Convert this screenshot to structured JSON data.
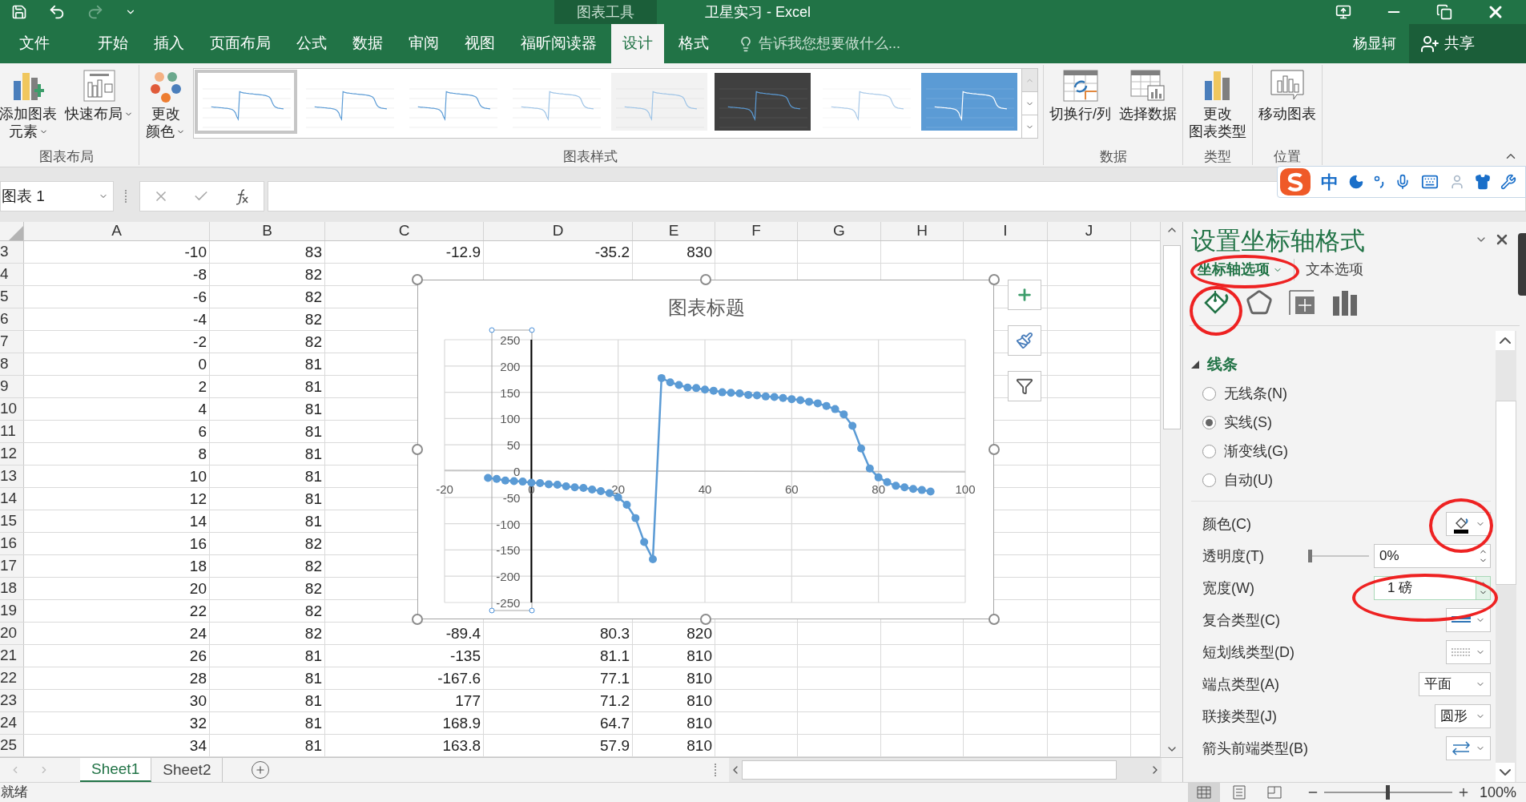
{
  "quick_access": [
    {
      "kind": "save",
      "disabled": false
    },
    {
      "kind": "undo",
      "disabled": false
    },
    {
      "kind": "redo",
      "disabled": true
    },
    {
      "kind": "customize",
      "disabled": false
    }
  ],
  "title_bar": {
    "context_label": "图表工具",
    "title": "卫星实习 - Excel"
  },
  "ribbon_tabs": [
    {
      "label": "文件",
      "selected": false
    },
    {
      "label": "开始",
      "selected": false
    },
    {
      "label": "插入",
      "selected": false
    },
    {
      "label": "页面布局",
      "selected": false
    },
    {
      "label": "公式",
      "selected": false
    },
    {
      "label": "数据",
      "selected": false
    },
    {
      "label": "审阅",
      "selected": false
    },
    {
      "label": "视图",
      "selected": false
    },
    {
      "label": "福昕阅读器",
      "selected": false
    },
    {
      "label": "设计",
      "selected": true
    },
    {
      "label": "格式",
      "selected": false
    }
  ],
  "tell_me": {
    "placeholder": "告诉我您想要做什么..."
  },
  "user": {
    "name": "杨显轲",
    "share": "共享"
  },
  "ribbon_groups": [
    {
      "kind": "buttons",
      "label": "图表布局",
      "buttons": [
        {
          "kind": "add_element",
          "lines": [
            "添加图表",
            "元素"
          ],
          "dropdown": true
        },
        {
          "kind": "quick_layout",
          "lines": [
            "快速布局"
          ],
          "dropdown": true
        }
      ]
    },
    {
      "kind": "gallery",
      "label": "图表样式",
      "color_button": {
        "lines": [
          "更改",
          "颜色"
        ],
        "dropdown": true
      },
      "styles": [
        {
          "kind": "plain",
          "selected": true
        },
        {
          "kind": "plain",
          "selected": false
        },
        {
          "kind": "plain",
          "selected": false
        },
        {
          "kind": "soft",
          "selected": false
        },
        {
          "kind": "gradient",
          "selected": false
        },
        {
          "kind": "dark",
          "selected": false
        },
        {
          "kind": "faded",
          "selected": false
        },
        {
          "kind": "blue",
          "selected": false
        }
      ]
    },
    {
      "kind": "buttons",
      "label": "数据",
      "buttons": [
        {
          "kind": "switch_row_column",
          "lines": [
            "切换行/列"
          ],
          "dropdown": false
        },
        {
          "kind": "select_data",
          "lines": [
            "选择数据"
          ],
          "dropdown": false
        }
      ]
    },
    {
      "kind": "buttons",
      "label": "类型",
      "buttons": [
        {
          "kind": "change_type",
          "lines": [
            "更改",
            "图表类型"
          ],
          "dropdown": false
        }
      ]
    },
    {
      "kind": "buttons",
      "label": "位置",
      "buttons": [
        {
          "kind": "move_chart",
          "lines": [
            "移动图表"
          ],
          "dropdown": false
        }
      ]
    }
  ],
  "formula_bar": {
    "name_box": "图表 1"
  },
  "ime_toolbar": {
    "mode": "中"
  },
  "columns": [
    "A",
    "B",
    "C",
    "D",
    "E",
    "F",
    "G",
    "H",
    "I",
    "J"
  ],
  "rows": [
    {
      "number": "3",
      "cells": [
        "-10",
        "83",
        "-12.9",
        "-35.2",
        "830"
      ]
    },
    {
      "number": "4",
      "cells": [
        "-8",
        "82"
      ]
    },
    {
      "number": "5",
      "cells": [
        "-6",
        "82"
      ]
    },
    {
      "number": "6",
      "cells": [
        "-4",
        "82"
      ]
    },
    {
      "number": "7",
      "cells": [
        "-2",
        "82"
      ]
    },
    {
      "number": "8",
      "cells": [
        "0",
        "81"
      ]
    },
    {
      "number": "9",
      "cells": [
        "2",
        "81"
      ]
    },
    {
      "number": "10",
      "cells": [
        "4",
        "81"
      ]
    },
    {
      "number": "11",
      "cells": [
        "6",
        "81"
      ]
    },
    {
      "number": "12",
      "cells": [
        "8",
        "81"
      ]
    },
    {
      "number": "13",
      "cells": [
        "10",
        "81"
      ]
    },
    {
      "number": "14",
      "cells": [
        "12",
        "81"
      ]
    },
    {
      "number": "15",
      "cells": [
        "14",
        "81"
      ]
    },
    {
      "number": "16",
      "cells": [
        "16",
        "82"
      ]
    },
    {
      "number": "17",
      "cells": [
        "18",
        "82"
      ]
    },
    {
      "number": "18",
      "cells": [
        "20",
        "82"
      ]
    },
    {
      "number": "19",
      "cells": [
        "22",
        "82"
      ]
    },
    {
      "number": "20",
      "cells": [
        "24",
        "82",
        "-89.4",
        "80.3",
        "820"
      ]
    },
    {
      "number": "21",
      "cells": [
        "26",
        "81",
        "-135",
        "81.1",
        "810"
      ]
    },
    {
      "number": "22",
      "cells": [
        "28",
        "81",
        "-167.6",
        "77.1",
        "810"
      ]
    },
    {
      "number": "23",
      "cells": [
        "30",
        "81",
        "177",
        "71.2",
        "810"
      ]
    },
    {
      "number": "24",
      "cells": [
        "32",
        "81",
        "168.9",
        "64.7",
        "810"
      ]
    },
    {
      "number": "25",
      "cells": [
        "34",
        "81",
        "163.8",
        "57.9",
        "810"
      ]
    }
  ],
  "chart": {
    "title": "图表标题",
    "y_axis_selected": true,
    "chart_data": {
      "type": "line",
      "grid": true,
      "xlim": [
        -20,
        100
      ],
      "ylim": [
        -250,
        250
      ],
      "xticks": [
        -20,
        0,
        20,
        40,
        60,
        80,
        100
      ],
      "yticks": [
        -250,
        -200,
        -150,
        -100,
        -50,
        0,
        50,
        100,
        150,
        200,
        250
      ],
      "x": [
        -10,
        -8,
        -6,
        -4,
        -2,
        0,
        2,
        4,
        6,
        8,
        10,
        12,
        14,
        16,
        18,
        20,
        22,
        24,
        26,
        28,
        30,
        32,
        34,
        36,
        38,
        40,
        42,
        44,
        46,
        48,
        50,
        52,
        54,
        56,
        58,
        60,
        62,
        64,
        66,
        68,
        70,
        72,
        74,
        76,
        78,
        80,
        82,
        84,
        86,
        88,
        90,
        92
      ],
      "series": [
        {
          "color": "#5b9bd5",
          "marker": true,
          "values": [
            -12.9,
            -14.8,
            -18,
            -19,
            -20,
            -22,
            -23,
            -25,
            -26,
            -29,
            -31,
            -32,
            -35,
            -38,
            -42,
            -50,
            -64,
            -89.4,
            -135,
            -167.6,
            177,
            168.9,
            163.8,
            159,
            158,
            155,
            153,
            150,
            149,
            148,
            145,
            144,
            142,
            141,
            139,
            137,
            135,
            132,
            129,
            124,
            118,
            108,
            86,
            43,
            5,
            -12,
            -21,
            -28,
            -31,
            -34,
            -36,
            -39
          ]
        }
      ]
    },
    "side_buttons": [
      {
        "kind": "elements"
      },
      {
        "kind": "styles"
      },
      {
        "kind": "filters"
      }
    ]
  },
  "sheet_tabs": [
    {
      "label": "Sheet1",
      "selected": true
    },
    {
      "label": "Sheet2",
      "selected": false
    }
  ],
  "status_bar": {
    "text": "就绪",
    "views": [
      {
        "kind": "normal",
        "selected": true
      },
      {
        "kind": "page_layout",
        "selected": false
      },
      {
        "kind": "page_break",
        "selected": false
      }
    ],
    "zoom": {
      "level": 0.5,
      "label": "100%"
    }
  },
  "panel": {
    "title": "设置坐标轴格式",
    "tabs": [
      {
        "label": "坐标轴选项",
        "selected": true
      },
      {
        "label": "文本选项",
        "selected": false
      }
    ],
    "icon_tabs": [
      {
        "kind": "fill_line",
        "selected": true
      },
      {
        "kind": "effects",
        "selected": false
      },
      {
        "kind": "size_properties",
        "selected": false
      },
      {
        "kind": "axis_options",
        "selected": false
      }
    ],
    "section": {
      "label": "线条",
      "expanded": true
    },
    "line_options": [
      {
        "label": "无线条(N)",
        "selected": false
      },
      {
        "label": "实线(S)",
        "selected": true
      },
      {
        "label": "渐变线(G)",
        "selected": false
      },
      {
        "label": "自动(U)",
        "selected": false
      }
    ],
    "properties": [
      {
        "kind": "color",
        "label": "颜色(C)"
      },
      {
        "kind": "slider",
        "label": "透明度(T)",
        "level": 0,
        "value": "0%"
      },
      {
        "kind": "spinner",
        "label": "宽度(W)",
        "value": "1 磅"
      },
      {
        "kind": "compound",
        "label": "复合类型(C)"
      },
      {
        "kind": "dash",
        "label": "短划线类型(D)"
      },
      {
        "kind": "select",
        "label": "端点类型(A)",
        "value": "平面"
      },
      {
        "kind": "select",
        "label": "联接类型(J)",
        "value": "圆形"
      },
      {
        "kind": "arrow",
        "label": "箭头前端类型(B)"
      }
    ]
  }
}
